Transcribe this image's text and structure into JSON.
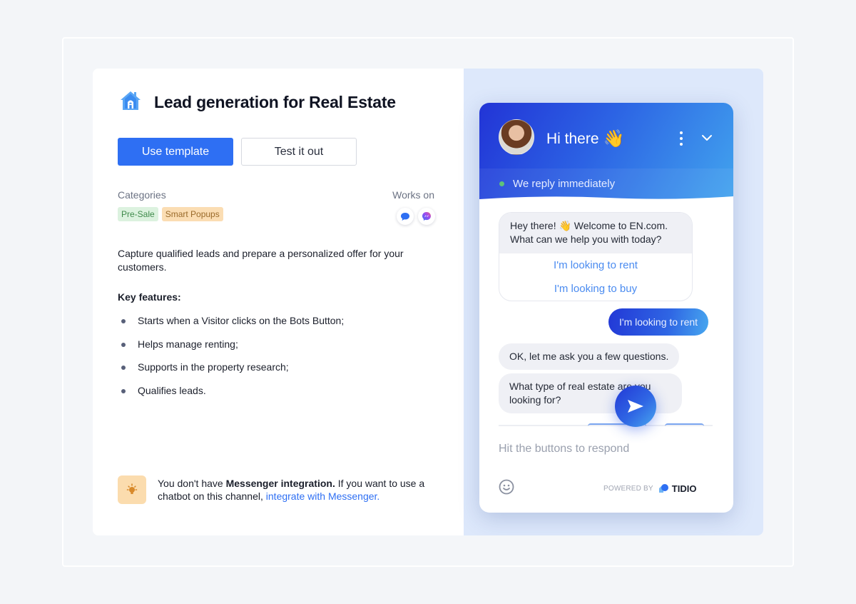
{
  "template": {
    "title": "Lead generation for Real Estate",
    "icon": "house-icon",
    "buttons": {
      "use_template": "Use template",
      "test_it_out": "Test it out"
    },
    "categories_label": "Categories",
    "categories": [
      {
        "label": "Pre-Sale",
        "color": "#dcf2df"
      },
      {
        "label": "Smart Popups",
        "color": "#fbddb3"
      }
    ],
    "works_on_label": "Works on",
    "channels": [
      "live-chat-icon",
      "messenger-icon"
    ],
    "description": "Capture qualified leads and prepare a personalized offer for your customers.",
    "key_features_label": "Key features:",
    "features": [
      "Starts when a Visitor clicks on the Bots Button;",
      "Helps manage renting;",
      "Supports in the property research;",
      "Qualifies leads."
    ],
    "notice": {
      "prefix": "You don't have ",
      "bold": "Messenger integration.",
      "middle": " If you want to use a chatbot on this channel, ",
      "link": "integrate with Messenger."
    }
  },
  "chat": {
    "greeting": "Hi there",
    "greeting_emoji": "👋",
    "status": "We reply immediately",
    "messages": {
      "welcome_line1": "Hey there! 👋 Welcome to EN.com.",
      "welcome_line2": "What can we help you with today?",
      "quick_replies": [
        "I'm looking to rent",
        "I'm looking to buy"
      ],
      "user_reply": "I'm looking to rent",
      "bot_followup": "OK, let me ask you a few questions.",
      "bot_question": "What type of real estate are you looking for?"
    },
    "input_placeholder": "Hit the buttons to respond",
    "powered_by": "POWERED BY",
    "brand": "TIDIO"
  },
  "colors": {
    "primary": "#2e6ff3",
    "chat_gradient_start": "#2234d6",
    "chat_gradient_end": "#42a4ee",
    "online": "#5fc37a"
  }
}
